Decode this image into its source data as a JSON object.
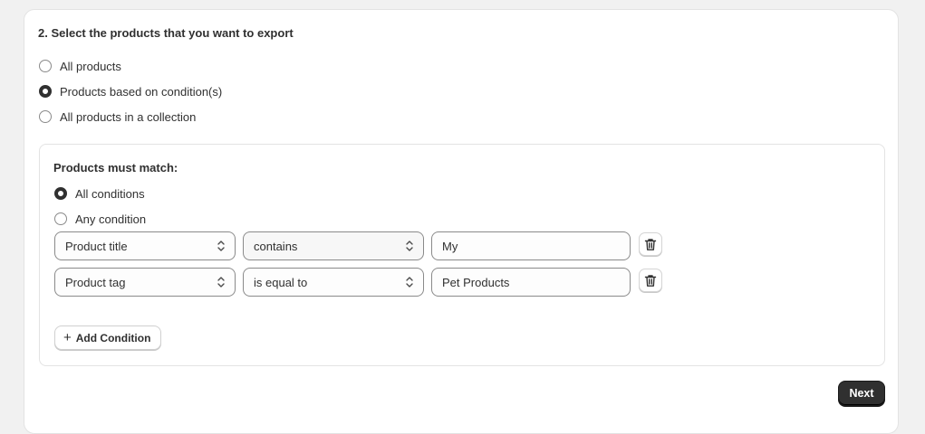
{
  "section": {
    "title": "2. Select the products that you want to export",
    "options": [
      {
        "label": "All products",
        "checked": false
      },
      {
        "label": "Products based on condition(s)",
        "checked": true
      },
      {
        "label": "All products in a collection",
        "checked": false
      }
    ]
  },
  "conditions": {
    "match_label": "Products must match:",
    "match_options": [
      {
        "label": "All conditions",
        "checked": true
      },
      {
        "label": "Any condition",
        "checked": false
      }
    ],
    "rows": [
      {
        "field": "Product title",
        "operator": "contains",
        "value": "My"
      },
      {
        "field": "Product tag",
        "operator": "is equal to",
        "value": "Pet Products"
      }
    ],
    "add_label": "Add Condition"
  },
  "footer": {
    "next_label": "Next"
  },
  "icons": {
    "delete": "trash-icon",
    "select": "chevron-up-down-icon",
    "add": "plus-icon"
  }
}
